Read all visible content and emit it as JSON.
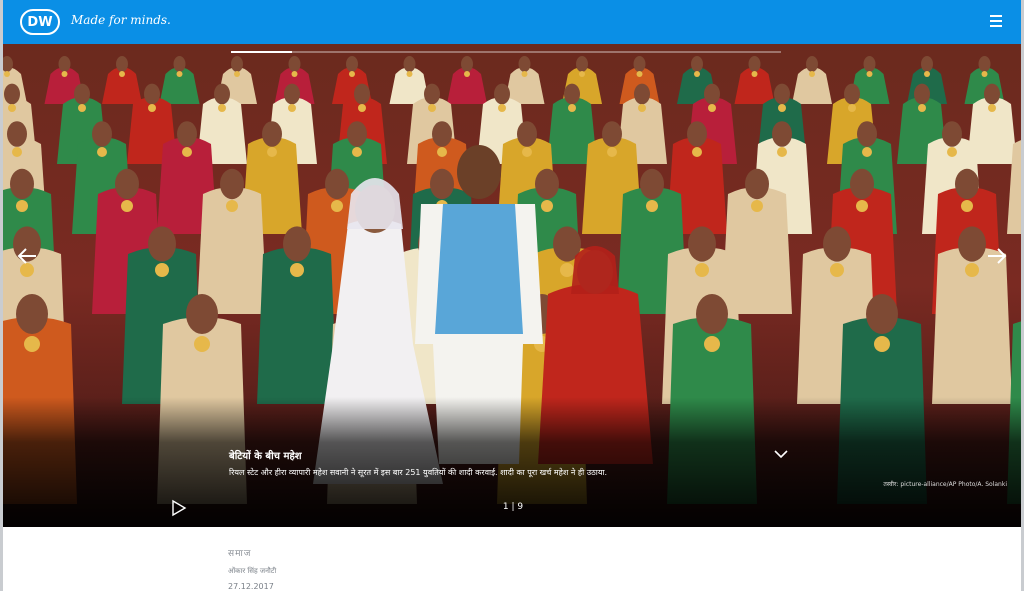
{
  "header": {
    "logo_text": "DW",
    "slogan": "Made for minds."
  },
  "gallery": {
    "caption_title": "बेटियों के बीच महेश",
    "caption_text": "रियल स्टेट और हीरा व्यापारी महेश सवानी ने सूरत में इस बार 251 युवतियों की शादी करवाई. शादी का पूरा खर्च महेश ने ही उठाया.",
    "credit": "तस्वीर: picture-alliance/AP Photo/A. Solanki",
    "counter": "1 | 9",
    "progress": 0.111
  },
  "article": {
    "category": "समाज",
    "author": "ओंकार सिंह जनौटी",
    "date": "27.12.2017"
  },
  "colors": {
    "header_bg": "#0a8fe6"
  },
  "icons": [
    "menu-icon",
    "arrow-left-icon",
    "arrow-right-icon",
    "chevron-down-icon",
    "play-icon"
  ]
}
